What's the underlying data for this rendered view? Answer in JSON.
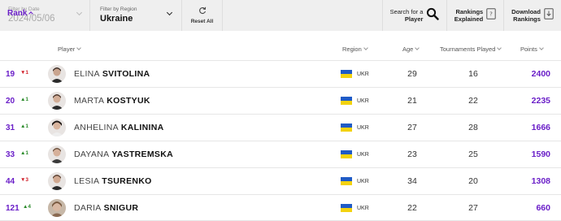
{
  "filters": {
    "date_label": "Filter by Date",
    "date_value": "2024/05/06",
    "region_label": "Filter by Region",
    "region_value": "Ukraine",
    "reset_label": "Reset All"
  },
  "toolbar": {
    "search_line1": "Search for a",
    "search_line2": "Player",
    "rankings_line1": "Rankings",
    "rankings_line2": "Explained",
    "download_line1": "Download",
    "download_line2": "Rankings"
  },
  "columns": {
    "rank": "Rank",
    "player": "Player",
    "region": "Region",
    "age": "Age",
    "tournaments": "Tournaments Played",
    "points": "Points"
  },
  "rows": [
    {
      "rank": "19",
      "move": "▼1",
      "dir": "down",
      "first": "ELINA",
      "last": "SVITOLINA",
      "country": "UKR",
      "age": "29",
      "tournaments": "16",
      "points": "2400"
    },
    {
      "rank": "20",
      "move": "▲1",
      "dir": "up",
      "first": "MARTA",
      "last": "KOSTYUK",
      "country": "UKR",
      "age": "21",
      "tournaments": "22",
      "points": "2235"
    },
    {
      "rank": "31",
      "move": "▲1",
      "dir": "up",
      "first": "ANHELINA",
      "last": "KALININA",
      "country": "UKR",
      "age": "27",
      "tournaments": "28",
      "points": "1666"
    },
    {
      "rank": "33",
      "move": "▲1",
      "dir": "up",
      "first": "DAYANA",
      "last": "YASTREMSKA",
      "country": "UKR",
      "age": "23",
      "tournaments": "25",
      "points": "1590"
    },
    {
      "rank": "44",
      "move": "▼3",
      "dir": "down",
      "first": "LESIA",
      "last": "TSURENKO",
      "country": "UKR",
      "age": "34",
      "tournaments": "20",
      "points": "1308"
    },
    {
      "rank": "121",
      "move": "▲4",
      "dir": "up",
      "first": "DARIA",
      "last": "SNIGUR",
      "country": "UKR",
      "age": "22",
      "tournaments": "27",
      "points": "660"
    }
  ],
  "colors": {
    "accent": "#6a1ec8",
    "up": "#2a8a2a",
    "down": "#d0202a",
    "flag_blue": "#1f5bc6",
    "flag_yellow": "#f3d20f"
  }
}
